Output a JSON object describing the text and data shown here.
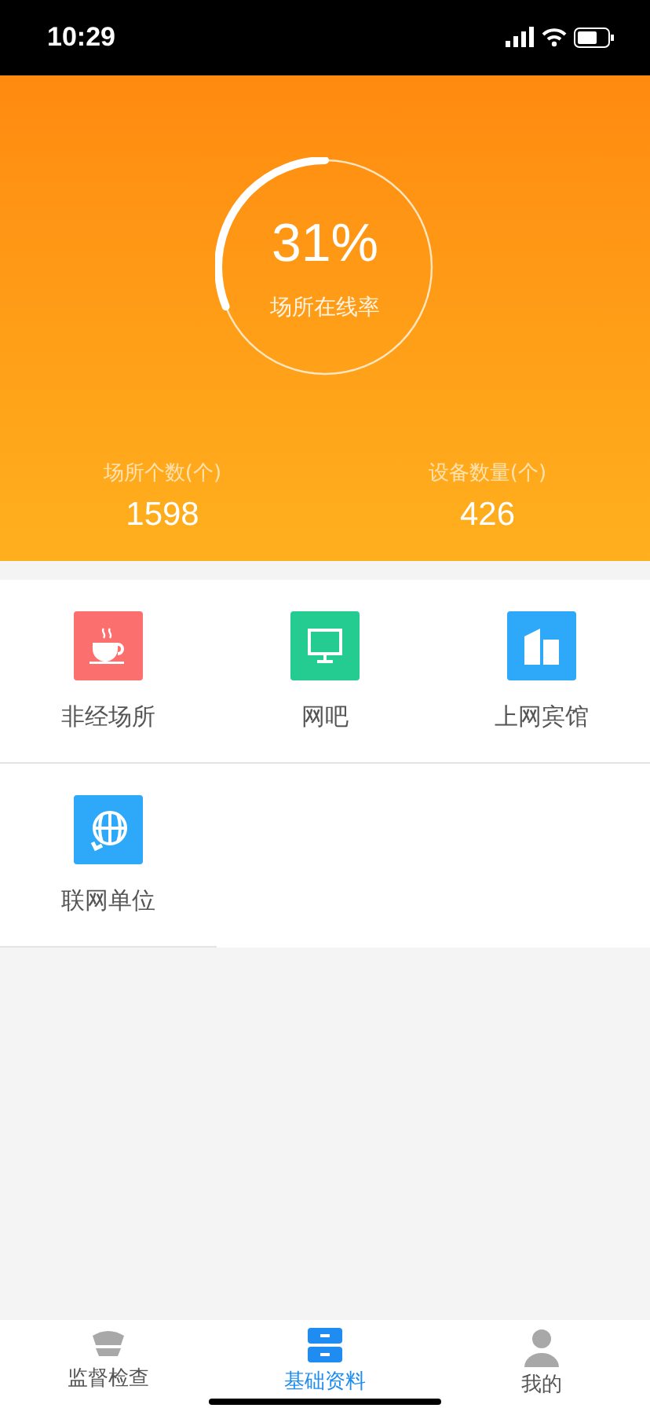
{
  "status_bar": {
    "time": "10:29"
  },
  "summary": {
    "percent": "31%",
    "label": "场所在线率",
    "level": 0.31,
    "stats": [
      {
        "label": "场所个数(个)",
        "value": "1598"
      },
      {
        "label": "设备数量(个)",
        "value": "426"
      }
    ]
  },
  "categories": [
    {
      "label": "非经场所",
      "kind": "cup",
      "color": "#fc6f6f"
    },
    {
      "label": "网吧",
      "kind": "monitor",
      "color": "#25cc92"
    },
    {
      "label": "上网宾馆",
      "kind": "building",
      "color": "#2ea8f8"
    },
    {
      "label": "联网单位",
      "kind": "globe",
      "color": "#2ea8f8"
    }
  ],
  "tab_bar": [
    {
      "label": "监督检查",
      "kind": "cap",
      "selected": false
    },
    {
      "label": "基础资料",
      "kind": "drawer",
      "selected": true
    },
    {
      "label": "我的",
      "kind": "person",
      "selected": false
    }
  ]
}
